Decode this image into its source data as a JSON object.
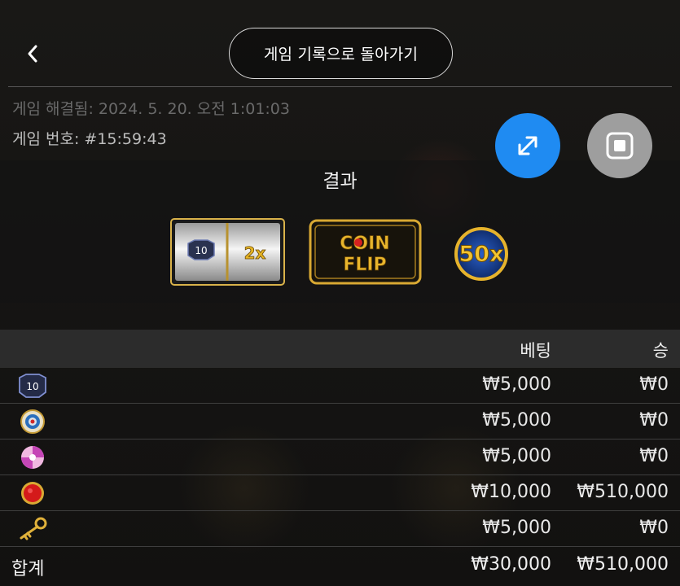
{
  "header": {
    "back_label": "<",
    "back_to_history_label": "게임 기록으로 돌아가기"
  },
  "meta": {
    "resolved": "게임 해결됨: 2024. 5. 20. 오전 1:01:03",
    "game_number": "게임 번호: #15:59:43"
  },
  "controls": {
    "expand_icon": "expand-arrows-icon",
    "stop_icon": "stop-square-icon",
    "expand_color": "#1f8bf2",
    "stop_color": "#9e9e9e"
  },
  "result": {
    "title": "결과",
    "slot": {
      "left_value": "10",
      "right_value": "2x"
    },
    "coin_flip": {
      "line1": "COIN",
      "line2": "FLIP"
    },
    "multiplier": "50x"
  },
  "table": {
    "headers": {
      "bet": "베팅",
      "win": "승"
    },
    "rows": [
      {
        "icon": "shield-10-icon",
        "icon_text": "10",
        "bet": "₩5,000",
        "win": "₩0"
      },
      {
        "icon": "target-icon",
        "bet": "₩5,000",
        "win": "₩0"
      },
      {
        "icon": "pachinko-candy-icon",
        "bet": "₩5,000",
        "win": "₩0"
      },
      {
        "icon": "coin-flip-red-icon",
        "bet": "₩10,000",
        "win": "₩510,000"
      },
      {
        "icon": "gold-key-icon",
        "bet": "₩5,000",
        "win": "₩0"
      }
    ],
    "total": {
      "label": "합계",
      "bet": "₩30,000",
      "win": "₩510,000"
    }
  }
}
